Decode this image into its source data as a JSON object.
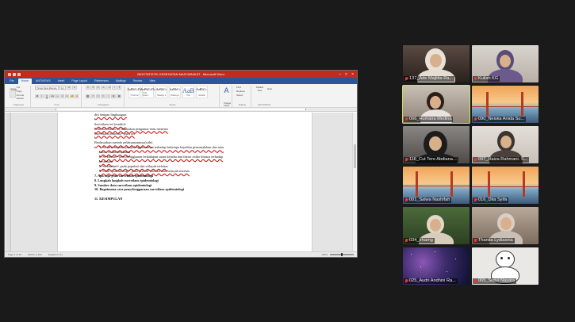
{
  "word": {
    "title": "BIOSTATISTIK KESEHATAN MASYARAKAT - Microsoft Word",
    "menu_tabs": [
      "File",
      "Home",
      "ANTIVIRUS",
      "Insert",
      "Page Layout",
      "References",
      "Mailings",
      "Review",
      "View"
    ],
    "active_tab": "Home",
    "ribbon": {
      "font_name": "Times New Roman",
      "font_size": "12",
      "styles": [
        {
          "sample": "AaBbCcDc",
          "name": "¶ Normal"
        },
        {
          "sample": "AaBbCcDc",
          "name": "¶ No Spaci..."
        },
        {
          "sample": "AaBbCc",
          "name": "Heading 1"
        },
        {
          "sample": "AaBbCc",
          "name": "Heading 2"
        },
        {
          "sample": "AaB",
          "name": "Title"
        },
        {
          "sample": "AaBbCc.",
          "name": "Subtitle"
        }
      ],
      "groups": {
        "clipboard": "Clipboard",
        "font": "Font",
        "paragraph": "Paragraph",
        "styles": "Styles",
        "editing": "Editing",
        "antivirus": "ANTIVIRUS"
      },
      "buttons": {
        "paste": "Paste",
        "cut": "Cut",
        "copy": "Copy",
        "format_painter": "Format Painter",
        "find": "Find",
        "replace": "Replace",
        "select": "Select",
        "change_styles": "Change Styles",
        "disable_now": "Disable Now",
        "scan": "Scan"
      }
    },
    "document_lines": [
      {
        "text": "diri dengan lingkungan.",
        "cls": "u"
      },
      {
        "text": "",
        "cls": "gap"
      },
      {
        "text": "Surveilans ini (sendiri)",
        "cls": "u"
      },
      {
        "text": "Jenis surveilans ini dilakukan pengamat tertu menerus",
        "cls": "u"
      },
      {
        "text": "Surveilans individu= jenis ini",
        "cls": "u"
      },
      {
        "text": "",
        "cls": "gap"
      },
      {
        "text": "Berdasarkan metode pelaksanaannya(side)",
        "cls": "u"
      },
      {
        "text": "1.  Se rutin terjadi= penyelenggaraannya terhadap beberapa kejadian permasalahan dan atau",
        "cls": "u ind1"
      },
      {
        "text": "     faktor risiko kesehatan",
        "cls": "u ind1"
      },
      {
        "text": "2.  Se khusus= penyelenggaraan terhadapan suatu kejadia dan faktor risiko khusus terhadap",
        "cls": "u ind1"
      },
      {
        "text": "     kesehatan",
        "cls": "u ind1"
      },
      {
        "text": "3.  Se sentinel= pada populasi dan wilayah terbatas",
        "cls": "u ind1"
      },
      {
        "text": "4.  Studi epidemiologi= pada periode tertentu atau wilayah tertentu",
        "cls": "u ind1"
      },
      {
        "text": "7.  Apa saja jenis surveilans epidemiologi",
        "cls": "b"
      },
      {
        "text": "8.  Langkah langkah surveilans epidemiologi",
        "cls": "b"
      },
      {
        "text": "9.  Sumber data surveilans epidemiologi",
        "cls": "b"
      },
      {
        "text": "10. Bagaimana cara penyelenggaraan surveilans epidemiologi",
        "cls": "b"
      },
      {
        "text": "",
        "cls": "gap"
      },
      {
        "text": "11. KESIMPULAN",
        "cls": "b"
      }
    ],
    "status": {
      "page": "Page 1 of 10",
      "words": "Words: 2,161",
      "language": "English (U.S.)",
      "zoom": "100%"
    }
  },
  "participants": [
    {
      "name": "137_Ade Majlitta Ra...",
      "muted": true
    },
    {
      "name": "Kuliah KG",
      "muted": true
    },
    {
      "name": "066_Humaira Medina",
      "muted": true,
      "active": true
    },
    {
      "name": "090_Neiska Anida Su...",
      "muted": true
    },
    {
      "name": "116_Cut Tere Abdiana...",
      "muted": true
    },
    {
      "name": "097_Haiza Rahmani. S...",
      "muted": true
    },
    {
      "name": "001_Salwa Nashifah",
      "muted": true
    },
    {
      "name": "016_Dita Syifa",
      "muted": true
    },
    {
      "name": "034_Irhamg",
      "muted": true
    },
    {
      "name": "Thanita Lydiasnia",
      "muted": true
    },
    {
      "name": "025_Audri Andhini Ra...",
      "muted": true
    },
    {
      "name": "065_Sepvi Nayara",
      "muted": true
    }
  ],
  "colors": {
    "word_title": "#c42b1c",
    "word_tabs": "#2b579a",
    "active_speaker": "#c6e05a",
    "muted_mic": "#e23b3b"
  }
}
